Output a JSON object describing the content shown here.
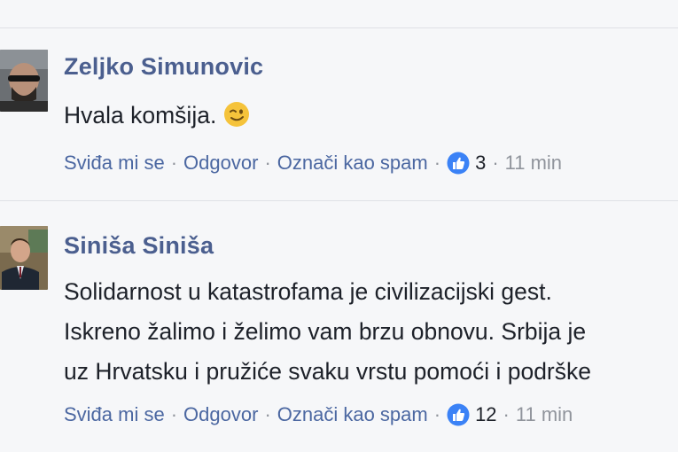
{
  "comments": [
    {
      "author": "Zeljko Simunovic",
      "lines": [
        "Hvala komšija."
      ],
      "emoji": "winking-face-emoji",
      "actions": {
        "like": "Sviđa mi se",
        "reply": "Odgovor",
        "spam": "Označi kao spam",
        "dot": "·",
        "like_count": "3",
        "time": "11 min"
      }
    },
    {
      "author": "Siniša Siniša",
      "lines": [
        "Solidarnost u katastrofama je civilizacijski gest.",
        "Iskreno žalimo i želimo vam brzu obnovu. Srbija je",
        "uz Hrvatsku i pružiće svaku vrstu pomoći i podrške"
      ],
      "actions": {
        "like": "Sviđa mi se",
        "reply": "Odgovor",
        "spam": "Označi kao spam",
        "dot": "·",
        "like_count": "12",
        "time": "11 min"
      }
    }
  ],
  "colors": {
    "link": "#4b67a1",
    "author": "#4b5f8f",
    "like_badge": "#3b82f6",
    "muted": "#90949c"
  }
}
